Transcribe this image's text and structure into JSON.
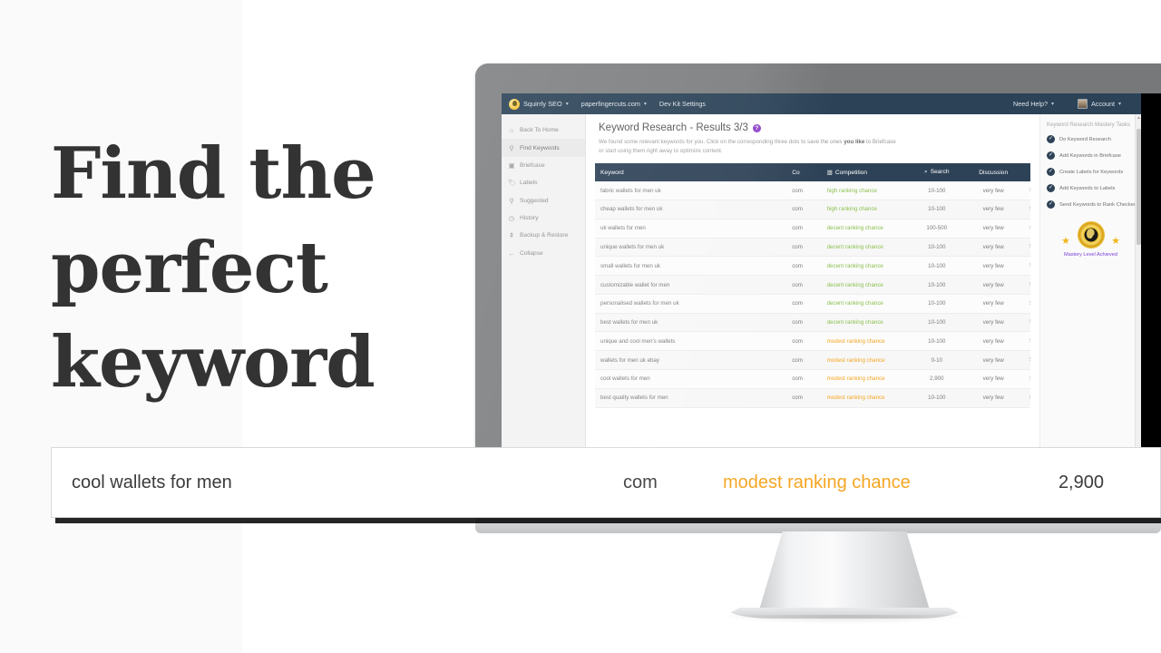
{
  "headline": "Find the\nperfect\nkeyword",
  "app": {
    "topbar": {
      "brand": "Squirrly SEO",
      "site": "paperfingercuts.com",
      "dev_settings": "Dev Kit Settings",
      "need_help": "Need Help?",
      "account": "Account",
      "caret": "▾"
    },
    "sidebar": {
      "items": [
        {
          "label": "Back To Home",
          "icon": "home-icon",
          "glyph": "⌂",
          "active": false
        },
        {
          "label": "Find Keywords",
          "icon": "key-icon",
          "glyph": "⚲",
          "active": true
        },
        {
          "label": "Briefcase",
          "icon": "briefcase-icon",
          "glyph": "▣",
          "active": false
        },
        {
          "label": "Labels",
          "icon": "tag-icon",
          "glyph": "🏷",
          "active": false
        },
        {
          "label": "Suggested",
          "icon": "bulb-icon",
          "glyph": "⚲",
          "active": false
        },
        {
          "label": "History",
          "icon": "clock-icon",
          "glyph": "◷",
          "active": false
        },
        {
          "label": "Backup & Restore",
          "icon": "upload-icon",
          "glyph": "⇞",
          "active": false
        },
        {
          "label": "Collapse",
          "icon": "arrow-left-icon",
          "glyph": "←",
          "active": false
        }
      ]
    },
    "page": {
      "title": "Keyword Research - Results 3/3",
      "help_glyph": "?",
      "description_1": "We found some relevant keywords for you. Click on the corresponding three dots to save the ones ",
      "description_bold": "you like",
      "description_2": " to Briefcase or start using them right away to optimize content."
    },
    "table": {
      "columns": [
        {
          "key": "keyword",
          "label": "Keyword",
          "icon": null
        },
        {
          "key": "co",
          "label": "Co",
          "icon": null
        },
        {
          "key": "competition",
          "label": "Competition",
          "icon": "bar-chart-icon",
          "glyph": "▥"
        },
        {
          "key": "search",
          "label": "Search",
          "icon": "magnifier-icon",
          "glyph": "⌕"
        },
        {
          "key": "discussion",
          "label": "Discussion",
          "icon": null
        }
      ],
      "rows": [
        {
          "keyword": "fabric wallets for men uk",
          "co": "com",
          "competition": "high ranking chance",
          "level": "high",
          "search": "10-100",
          "discussion": "very few"
        },
        {
          "keyword": "cheap wallets for men uk",
          "co": "com",
          "competition": "high ranking chance",
          "level": "high",
          "search": "10-100",
          "discussion": "very few"
        },
        {
          "keyword": "uk wallets for men",
          "co": "com",
          "competition": "decent ranking chance",
          "level": "decent",
          "search": "100-500",
          "discussion": "very few"
        },
        {
          "keyword": "unique wallets for men uk",
          "co": "com",
          "competition": "decent ranking chance",
          "level": "decent",
          "search": "10-100",
          "discussion": "very few"
        },
        {
          "keyword": "small wallets for men uk",
          "co": "com",
          "competition": "decent ranking chance",
          "level": "decent",
          "search": "10-100",
          "discussion": "very few"
        },
        {
          "keyword": "customizable wallet for men",
          "co": "com",
          "competition": "decent ranking chance",
          "level": "decent",
          "search": "10-100",
          "discussion": "very few"
        },
        {
          "keyword": "personalised wallets for men uk",
          "co": "com",
          "competition": "decent ranking chance",
          "level": "decent",
          "search": "10-100",
          "discussion": "very few"
        },
        {
          "keyword": "best wallets for men uk",
          "co": "com",
          "competition": "decent ranking chance",
          "level": "decent",
          "search": "10-100",
          "discussion": "very few"
        },
        {
          "keyword": "unique and cool men's wallets",
          "co": "com",
          "competition": "modest ranking chance",
          "level": "modest",
          "search": "10-100",
          "discussion": "very few"
        },
        {
          "keyword": "wallets for men uk ebay",
          "co": "com",
          "competition": "modest ranking chance",
          "level": "modest",
          "search": "0-10",
          "discussion": "very few"
        },
        {
          "keyword": "cool wallets for men",
          "co": "com",
          "competition": "modest ranking chance",
          "level": "modest",
          "search": "2,900",
          "discussion": "very few"
        },
        {
          "keyword": "best quality wallets for men",
          "co": "com",
          "competition": "modest ranking chance",
          "level": "modest",
          "search": "10-100",
          "discussion": "very few"
        }
      ],
      "row_menu_glyph": "⋮"
    },
    "rail": {
      "title": "Keyword Research Mastery Tasks",
      "check_glyph": "✓",
      "tasks": [
        {
          "label": "Do Keyword Research",
          "done": true
        },
        {
          "label": "Add Keywords in Briefcase",
          "done": true
        },
        {
          "label": "Create Labels for Keywords",
          "done": true
        },
        {
          "label": "Add Keywords to Labels",
          "done": true
        },
        {
          "label": "Send Keywords to Rank Checker",
          "done": true
        }
      ],
      "badge_text": "Mastery Level Achieved",
      "star_glyph": "★"
    }
  },
  "callout": {
    "keyword": "cool wallets for men",
    "co": "com",
    "competition": "modest ranking chance",
    "search_volume": "2,900"
  },
  "colors": {
    "accent_orange": "#f5a623",
    "accent_green": "#8cc152",
    "topbar_navy": "#2b4257",
    "table_header_navy": "#2e4257",
    "purple_dots": "#6c3fd6",
    "badge_purple": "#7b3fd6",
    "gold": "#f0b81c",
    "headline": "#333333"
  }
}
